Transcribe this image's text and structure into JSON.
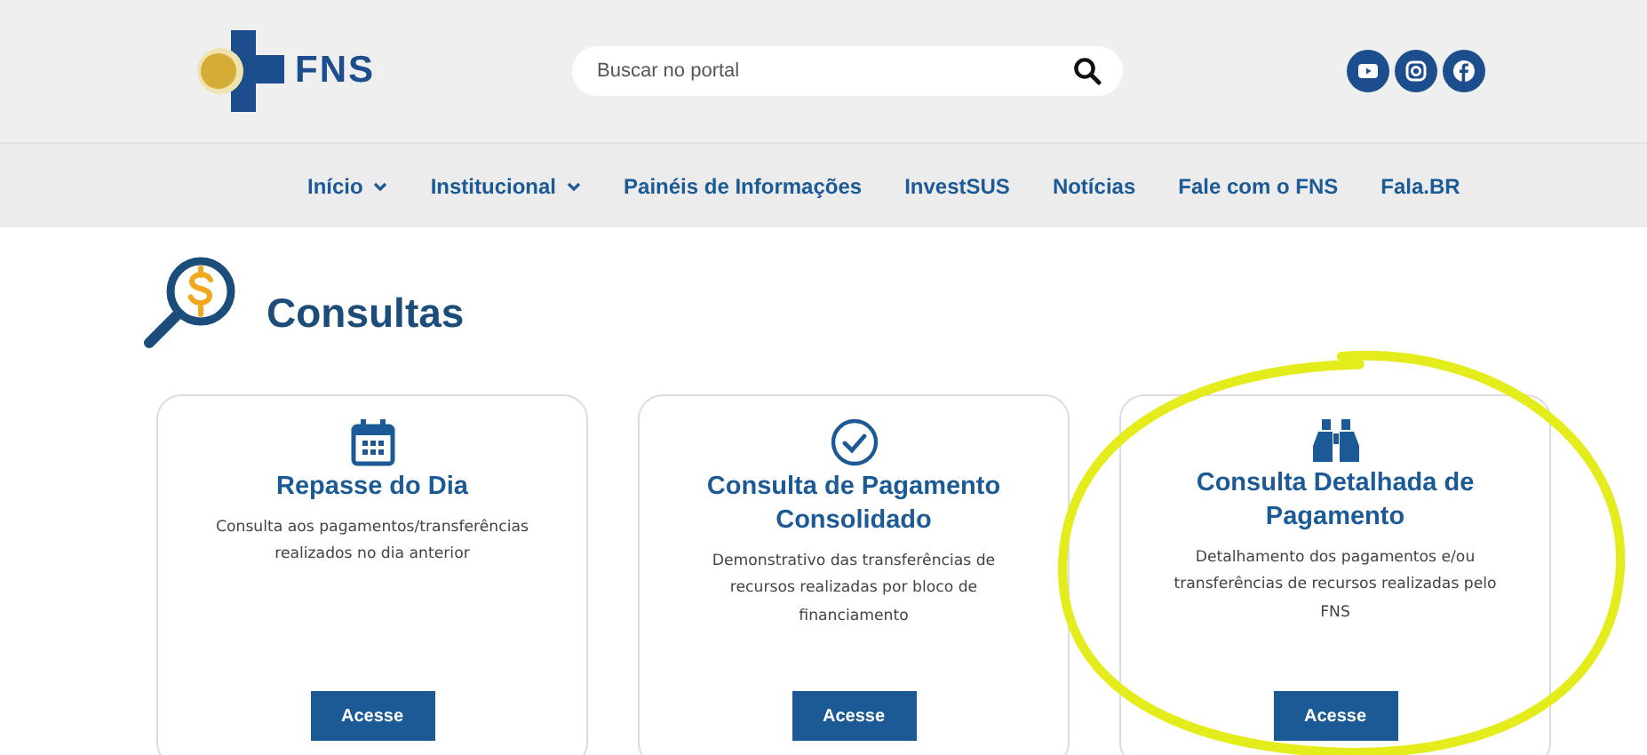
{
  "header": {
    "logo_text": "FNS",
    "search": {
      "placeholder": "Buscar no portal"
    },
    "social": [
      {
        "kind": "youtube"
      },
      {
        "kind": "instagram"
      },
      {
        "kind": "facebook"
      }
    ]
  },
  "nav": [
    {
      "label": "Início",
      "dropdown": true
    },
    {
      "label": "Institucional",
      "dropdown": true
    },
    {
      "label": "Painéis de Informações",
      "dropdown": false
    },
    {
      "label": "InvestSUS",
      "dropdown": false
    },
    {
      "label": "Notícias",
      "dropdown": false
    },
    {
      "label": "Fale com o FNS",
      "dropdown": false
    },
    {
      "label": "Fala.BR",
      "dropdown": false
    }
  ],
  "page_title": "Consultas",
  "cards": [
    {
      "kind": "calendar",
      "title": "Repasse do Dia",
      "description": "Consulta aos pagamentos/transferências realizados no dia anterior",
      "button": "Acesse",
      "circled": false
    },
    {
      "kind": "check",
      "title": "Consulta de Pagamento Consolidado",
      "description": "Demonstrativo das transferências de recursos realizadas por bloco de financiamento",
      "button": "Acesse",
      "circled": false
    },
    {
      "kind": "binoculars",
      "title": "Consulta Detalhada de Pagamento",
      "description": "Detalhamento dos pagamentos e/ou transferências de recursos realizadas pelo FNS",
      "button": "Acesse",
      "circled": true
    }
  ]
}
